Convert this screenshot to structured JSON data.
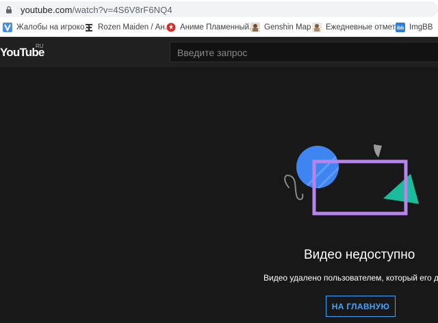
{
  "browser": {
    "url_host": "youtube.com",
    "url_path": "/watch?v=4S6V8rF6NQ4",
    "bookmarks": [
      {
        "label": "Жалобы на игроко...",
        "icon": "v-shield-icon"
      },
      {
        "label": "Rozen Maiden / Ан...",
        "icon": "rozen-icon"
      },
      {
        "label": "Аниме Пламенный...",
        "icon": "anime-icon"
      },
      {
        "label": "Genshin Map",
        "icon": "genshin-icon"
      },
      {
        "label": "Ежедневные отмет...",
        "icon": "daily-icon"
      },
      {
        "label": "ImgBB",
        "icon": "imgbb-icon"
      }
    ]
  },
  "header": {
    "logo": "YouTube",
    "country": "RU",
    "search_placeholder": "Введите запрос"
  },
  "main": {
    "title": "Видео недоступно",
    "description": "Видео удалено пользователем, который его доб",
    "home_button": "НА ГЛАВНУЮ"
  },
  "colors": {
    "background": "#181818",
    "header": "#202020",
    "accent": "#3ea6ff",
    "illustration_circle": "#3f85f2",
    "illustration_frame": "#b784ed",
    "illustration_triangle": "#1abc9c"
  }
}
